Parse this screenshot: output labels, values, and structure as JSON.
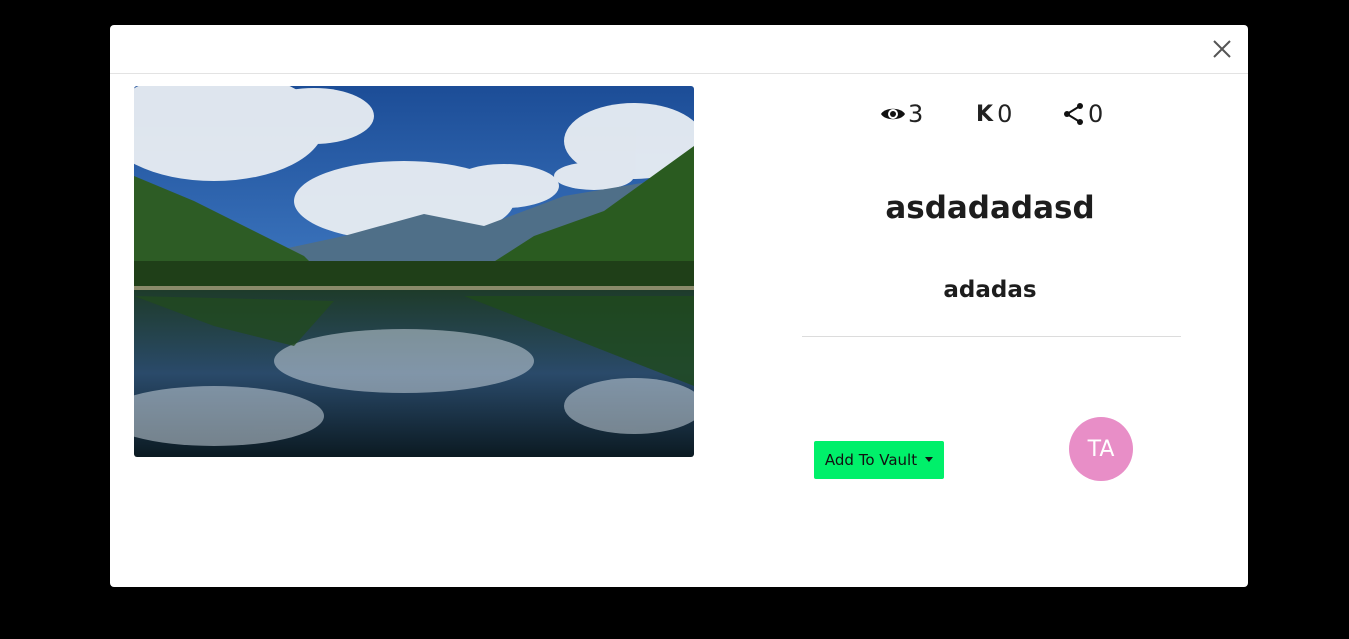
{
  "post": {
    "title": "asdadadasd",
    "subtitle": "adadas",
    "image_alt": "mountain lake reflection"
  },
  "stats": {
    "views": "3",
    "karma_symbol": "K",
    "karma": "0",
    "shares": "0"
  },
  "actions": {
    "add_to_vault": "Add To Vault"
  },
  "author": {
    "initials": "TA"
  },
  "colors": {
    "vault_button": "#00f06a",
    "avatar_bg": "#e88ec7",
    "overlay": "#000000"
  },
  "icons": {
    "close": "close-icon",
    "views": "eye-icon",
    "shares": "share-icon",
    "dropdown": "caret-down-icon"
  }
}
